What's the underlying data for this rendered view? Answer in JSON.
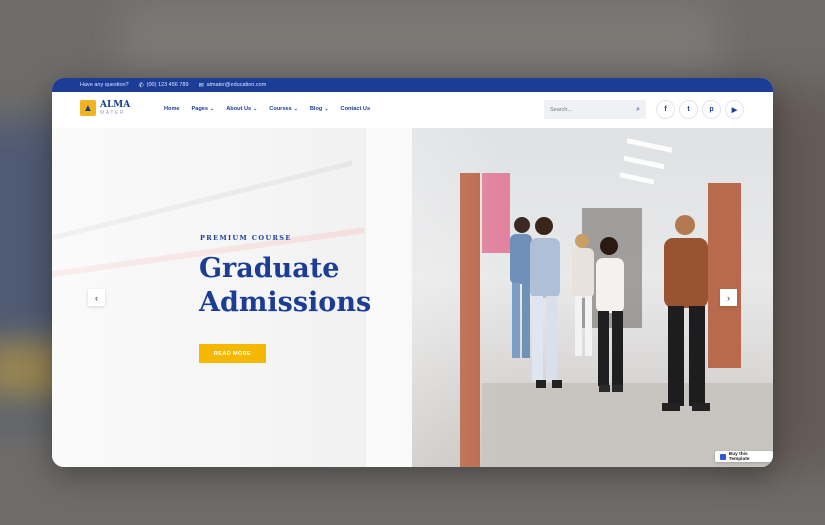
{
  "topbar": {
    "question": "Have any question?",
    "phone": "(00) 123 456 789",
    "email": "almater@education.com"
  },
  "logo": {
    "name": "ALMA",
    "sub": "MATER"
  },
  "nav": [
    {
      "label": "Home",
      "dropdown": false
    },
    {
      "label": "Pages",
      "dropdown": true
    },
    {
      "label": "About Us",
      "dropdown": true
    },
    {
      "label": "Courses",
      "dropdown": true
    },
    {
      "label": "Blog",
      "dropdown": true
    },
    {
      "label": "Contact Us",
      "dropdown": false
    }
  ],
  "search": {
    "placeholder": "Search..."
  },
  "socials": [
    "facebook-icon",
    "twitter-icon",
    "pinterest-icon",
    "youtube-icon"
  ],
  "hero": {
    "tagline": "PREMIUM COURSE",
    "title_line1": "Graduate",
    "title_line2": "Admissions",
    "cta": "READ MORE"
  },
  "buy_badge": "Buy this Template",
  "colors": {
    "brand": "#1c3d96",
    "accent": "#f5b800"
  }
}
